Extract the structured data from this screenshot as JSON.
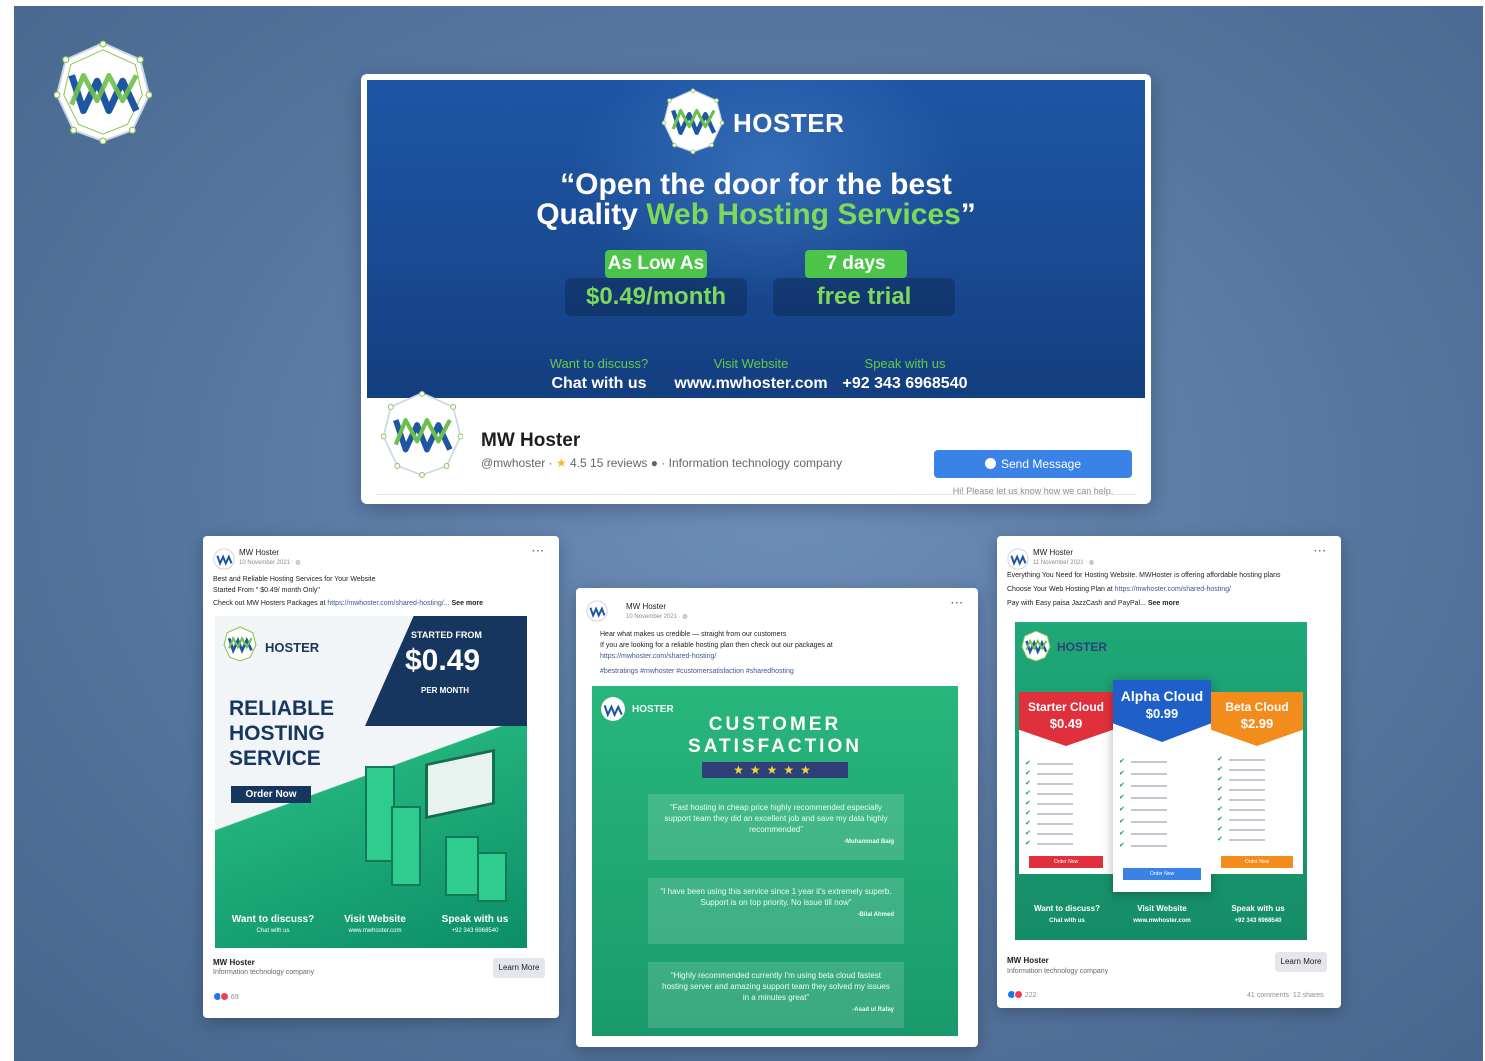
{
  "brand": {
    "name": "HOSTER",
    "accent_green": "#7ed957",
    "navy": "#16365f",
    "fb_blue": "#3b82e6"
  },
  "cover": {
    "headline_line1": "“Open the door for the best",
    "headline_line2_plain": "Quality ",
    "headline_line2_hl": "Web Hosting Services",
    "headline_line2_end": "”",
    "pill1_label": "As Low As",
    "pill1_value": "$0.49/month",
    "pill2_label": "7 days",
    "pill2_value": "free trial",
    "contacts": [
      {
        "label": "Want to discuss?",
        "value": "Chat with us"
      },
      {
        "label": "Visit Website",
        "value": "www.mwhoster.com"
      },
      {
        "label": "Speak with us",
        "value": "+92 343 6968540"
      }
    ]
  },
  "page": {
    "name": "MW Hoster",
    "handle": "@mwhoster",
    "rating": "4.5",
    "reviews": "15 reviews",
    "category": "Information technology company",
    "send_button": "Send Message",
    "send_hint": "Hi! Please let us know how we can help."
  },
  "post1": {
    "author": "MW Hoster",
    "date": "10 November 2021 · ",
    "line1": "Best and Reliable Hosting Services for Your Website",
    "line2": "Started From \" $0.49/ month Only\"",
    "line3_prefix": "Check out MW Hosters Packages at ",
    "line3_link": "https://mwhoster.com/shared-hosting/...",
    "see_more": " See more",
    "ad": {
      "started": "STARTED FROM",
      "price": "$0.49",
      "per_month": "PER MONTH",
      "title": "RELIABLE HOSTING SERVICE",
      "order": "Order Now",
      "contacts": [
        {
          "label": "Want to discuss?",
          "value": "Chat with us"
        },
        {
          "label": "Visit Website",
          "value": "www.mwhoster.com"
        },
        {
          "label": "Speak with us",
          "value": "+92 343 6968540"
        }
      ]
    },
    "footer_name": "MW Hoster",
    "footer_category": "Information technology company",
    "learn_more": "Learn More",
    "reactions": "69"
  },
  "post2": {
    "author": "MW Hoster",
    "date": "10 November 2021 · ",
    "line1": "Hear what makes us credible — straight from our customers",
    "line2": "If you are looking for a reliable hosting plan then check out our packages at",
    "line3_link": "https://mwhoster.com/shared-hosting/",
    "tags": "#bestratings #mwhoster #customersatisfaction #sharedhosting",
    "ad": {
      "title_1": "CUSTOMER",
      "title_2": "SATISFACTION",
      "stars": "★★★★★",
      "quotes": [
        {
          "text": "“Fast hosting in cheap price highly recommended especially support team they did an excellent job and save my data highly recommended”",
          "who": "-Muhammad Baig"
        },
        {
          "text": "“I have been using this service since 1 year it's extremely superb. Support is on top priority. No issue till now”",
          "who": "-Bilal Ahmed"
        },
        {
          "text": "“Highly recommended currently I'm using beta cloud fastest hosting server and amazing support team they solved my issues in a minutes great”",
          "who": "-Asad ul Rafay"
        }
      ]
    }
  },
  "post3": {
    "author": "MW Hoster",
    "date": "11 November 2021 · ",
    "line1": "Everything You Need for Hosting Website. MWHoster is offering affordable hosting plans",
    "line2_prefix": "Choose Your Web Hosting Plan at ",
    "line2_link": "https://mwhoster.com/shared-hosting/",
    "line3": "Pay with Easy paisa JazzCash and PayPal...",
    "see_more": " See more",
    "ad": {
      "plans": [
        {
          "name": "Starter Cloud",
          "price": "$0.49",
          "color": "#e0303c",
          "button": "Order Now"
        },
        {
          "name": "Alpha Cloud",
          "price": "$0.99",
          "color": "#1f5fc9",
          "button": "Order Now"
        },
        {
          "name": "Beta Cloud",
          "price": "$2.99",
          "color": "#f28c1c",
          "button": "Order Now"
        }
      ],
      "contacts": [
        {
          "label": "Want to discuss?",
          "value": "Chat with us"
        },
        {
          "label": "Visit Website",
          "value": "www.mwhoster.com"
        },
        {
          "label": "Speak with us",
          "value": "+92 343 6968540"
        }
      ]
    },
    "footer_name": "MW Hoster",
    "footer_category": "Information technology company",
    "learn_more": "Learn More",
    "reactions": "222",
    "comments": "41 comments",
    "shares": "12 shares"
  }
}
